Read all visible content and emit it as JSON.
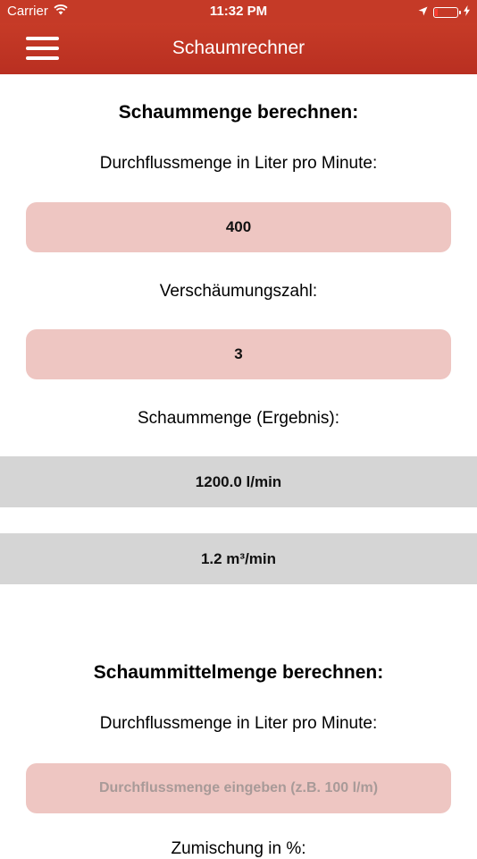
{
  "status_bar": {
    "carrier": "Carrier",
    "time": "11:32 PM",
    "icons": [
      "wifi-icon",
      "location-arrow-icon",
      "battery-icon",
      "charging-bolt-icon"
    ]
  },
  "nav": {
    "title": "Schaumrechner",
    "menu_icon": "hamburger-menu-icon"
  },
  "foam_section": {
    "heading": "Schaummenge berechnen:",
    "flow_label": "Durchflussmenge in Liter pro Minute:",
    "flow_value": "400",
    "expansion_label": "Verschäumungszahl:",
    "expansion_value": "3",
    "result_label": "Schaummenge (Ergebnis):",
    "result_lpm": "1200.0 l/min",
    "result_m3": "1.2 m³/min"
  },
  "agent_section": {
    "heading": "Schaummittelmenge berechnen:",
    "flow_label": "Durchflussmenge in Liter pro Minute:",
    "flow_placeholder": "Durchflussmenge eingeben (z.B. 100 l/m)",
    "mix_label": "Zumischung in %:"
  },
  "colors": {
    "bar": "#c53a27",
    "input_bg": "#eec6c2",
    "result_bg": "#d5d5d5"
  }
}
